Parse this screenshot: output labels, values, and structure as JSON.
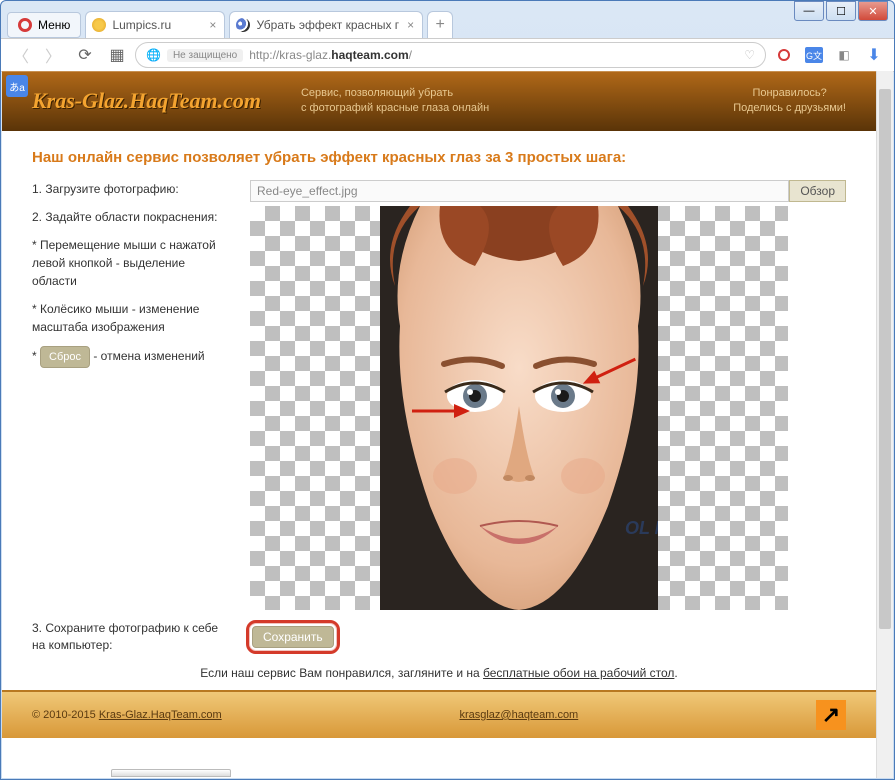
{
  "window": {
    "menu_label": "Меню",
    "tabs": [
      {
        "title": "Lumpics.ru"
      },
      {
        "title": "Убрать эффект красных г"
      }
    ],
    "tab_close": "×",
    "new_tab": "+",
    "win_min": "—",
    "win_max": "☐",
    "win_close": "✕"
  },
  "address": {
    "insecure_label": "Не защищено",
    "url_prefix": "http://kras-glaz.",
    "url_bold": "haqteam.com",
    "url_suffix": "/",
    "heart": "♡"
  },
  "translate_badge": "あa",
  "header": {
    "logo": "Kras-Glaz.HaqTeam.com",
    "tagline_line1": "Сервис, позволяющий убрать",
    "tagline_line2": "с фотографий красные глаза онлайн",
    "share_line1": "Понравилось?",
    "share_line2": "Поделись с друзьями!"
  },
  "page": {
    "h2": "Наш онлайн сервис позволяет убрать эффект красных глаз за 3 простых шага:",
    "step1": "1. Загрузите фотографию:",
    "step2": "2. Задайте области покраснения:",
    "instr1": "* Перемещение мыши с нажатой левой кнопкой - выделение области",
    "instr2": "* Колёсико мыши - изменение масштаба изображения",
    "instr3_prefix": "* ",
    "reset_btn": "Сброс",
    "instr3_suffix": " - отмена изменений",
    "file_value": "Red-eye_effect.jpg",
    "browse_btn": "Обзор",
    "step3": "3. Сохраните фотографию к себе на компьютер:",
    "save_btn": "Сохранить",
    "like_prefix": "Если наш сервис Вам понравился, загляните и на ",
    "like_link": "бесплатные обои на рабочий стол",
    "like_suffix": "."
  },
  "footer": {
    "copyright": "© 2010-2015 ",
    "copyright_link": "Kras-Glaz.HaqTeam.com",
    "email": "krasglaz@haqteam.com",
    "counter": "↗"
  }
}
